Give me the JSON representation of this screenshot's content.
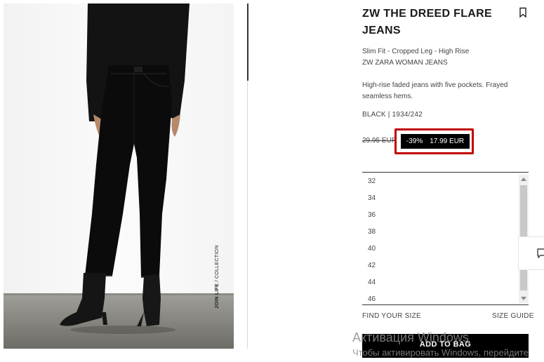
{
  "product": {
    "title": "ZW THE DREED FLARE JEANS",
    "subtitle_line1": "Slim Fit - Cropped Leg - High Rise",
    "subtitle_line2": "ZW ZARA WOMAN JEANS",
    "description": "High-rise faded jeans with five pockets. Frayed seamless hems.",
    "color_ref": "BLACK | 1934/242",
    "old_price": "29.95 EUR",
    "discount": "-39%",
    "price": "17.99 EUR",
    "image_caption_bold": "JOIN LIFE",
    "image_caption_rest": " / COLLECTION"
  },
  "sizes": [
    "32",
    "34",
    "36",
    "38",
    "40",
    "42",
    "44",
    "46"
  ],
  "links": {
    "find_your_size": "FIND YOUR SIZE",
    "size_guide": "SIZE GUIDE"
  },
  "actions": {
    "add_to_bag": "ADD TO BAG"
  },
  "icons": {
    "bookmark": "bookmark-icon",
    "chat": "chat-icon"
  },
  "watermark": {
    "line1": "Активация Windows",
    "line2": "Чтобы активировать Windows, перейдите"
  },
  "colors": {
    "highlight": "#c00000",
    "badge": "#000000"
  }
}
